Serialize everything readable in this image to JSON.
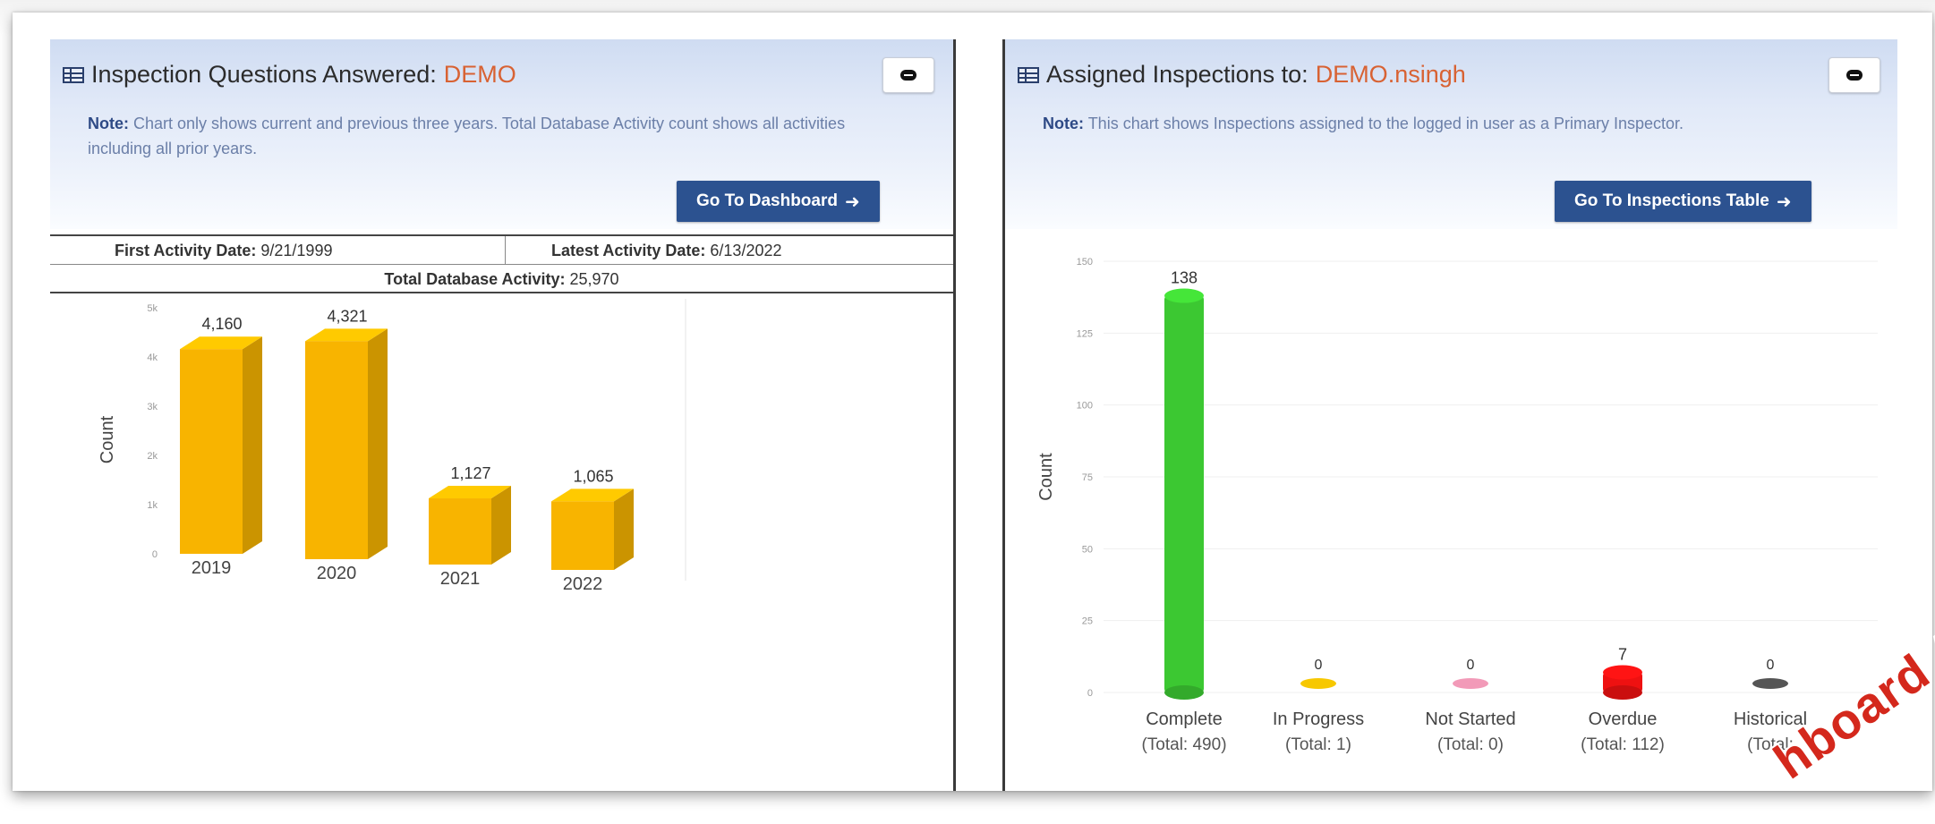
{
  "left_panel": {
    "title_prefix": "Inspection Questions Answered:",
    "title_accent": "DEMO",
    "note_label": "Note:",
    "note_text": "Chart only shows current and previous three years. Total Database Activity count shows all activities including all prior years.",
    "button_label": "Go To Dashboard",
    "first_activity_label": "First Activity Date:",
    "first_activity_value": "9/21/1999",
    "latest_activity_label": "Latest Activity Date:",
    "latest_activity_value": "6/13/2022",
    "total_activity_label": "Total Database Activity:",
    "total_activity_value": "25,970"
  },
  "right_panel": {
    "title_prefix": "Assigned Inspections to:",
    "title_accent": "DEMO.nsingh",
    "note_label": "Note:",
    "note_text": "This chart shows Inspections assigned to the logged in user as a Primary Inspector.",
    "button_label": "Go To Inspections Table"
  },
  "watermark_text": "hboard An",
  "colors": {
    "accent_title": "#d86233",
    "button_bg": "#2c5290",
    "bar_yellow": "#f8b400",
    "complete_green": "#3cc832",
    "inprogress_yellow": "#f7c800",
    "notstarted_pink": "#f29ab8",
    "overdue_red": "#ee1111",
    "historical_gray": "#555555"
  },
  "chart_data": [
    {
      "type": "bar",
      "ylabel": "Count",
      "ylim": [
        0,
        5000
      ],
      "yticks": [
        "0",
        "1k",
        "2k",
        "3k",
        "4k",
        "5k"
      ],
      "categories": [
        "2019",
        "2020",
        "2021",
        "2022"
      ],
      "values": [
        4160,
        4321,
        1127,
        1065
      ],
      "data_labels": [
        "4,160",
        "4,321",
        "1,127",
        "1,065"
      ],
      "grid": false
    },
    {
      "type": "bar",
      "ylabel": "Count",
      "ylim": [
        0,
        150
      ],
      "yticks": [
        "0",
        "25",
        "50",
        "75",
        "100",
        "125",
        "150"
      ],
      "categories": [
        "Complete",
        "In Progress",
        "Not Started",
        "Overdue",
        "Historical"
      ],
      "totals": [
        "(Total: 490)",
        "(Total: 1)",
        "(Total: 0)",
        "(Total: 112)",
        "(Total:"
      ],
      "values": [
        138,
        0,
        0,
        7,
        0
      ],
      "data_labels": [
        "138",
        "0",
        "0",
        "7",
        "0"
      ],
      "grid": true
    }
  ]
}
